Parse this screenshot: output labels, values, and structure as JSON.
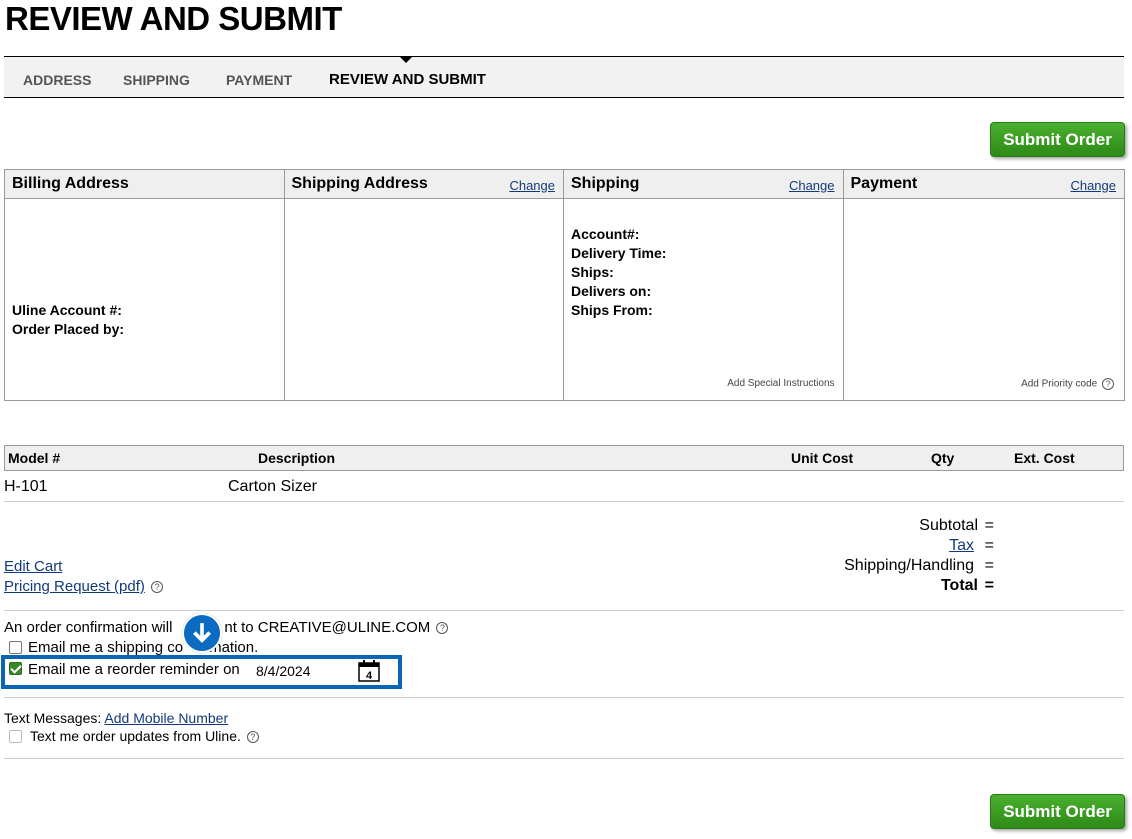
{
  "page": {
    "title": "REVIEW AND SUBMIT"
  },
  "steps": [
    {
      "label": "ADDRESS"
    },
    {
      "label": "SHIPPING"
    },
    {
      "label": "PAYMENT"
    },
    {
      "label": "REVIEW AND SUBMIT",
      "active": true
    }
  ],
  "submit_label": "Submit Order",
  "billing": {
    "heading": "Billing Address",
    "account_label": "Uline Account #:",
    "placed_by_label": "Order Placed by:"
  },
  "shipping_address": {
    "heading": "Shipping Address",
    "change": "Change"
  },
  "shipping": {
    "heading": "Shipping",
    "change": "Change",
    "fields": [
      "Account#:",
      "Delivery Time:",
      "Ships:",
      "Delivers on:",
      "Ships From:"
    ],
    "special_instructions": "Add Special Instructions"
  },
  "payment": {
    "heading": "Payment",
    "change": "Change",
    "priority_code": "Add Priority code"
  },
  "items": {
    "headers": {
      "model": "Model #",
      "description": "Description",
      "unit_cost": "Unit Cost",
      "qty": "Qty",
      "ext_cost": "Ext. Cost"
    },
    "rows": [
      {
        "model": "H-101",
        "description": "Carton Sizer"
      }
    ]
  },
  "links": {
    "edit_cart": "Edit Cart",
    "pricing_request": "Pricing Request (pdf)"
  },
  "totals": {
    "subtotal": "Subtotal",
    "tax": "Tax",
    "shipping": "Shipping/Handling",
    "total": "Total",
    "eq": "="
  },
  "email": {
    "confirmation_prefix": "An order confirmation will",
    "confirmation_suffix": "nt to CREATIVE@ULINE.COM",
    "shipping_confirmation": "Email me a shipping co",
    "shipping_confirmation_tail": "mation.",
    "reorder_label": "Email me a reorder reminder on",
    "reorder_date": "8/4/2024",
    "calendar_day": "4"
  },
  "text_messages": {
    "label": "Text Messages:",
    "add_mobile": "Add Mobile Number",
    "updates": "Text me order updates from Uline."
  },
  "colors": {
    "accent": "#0a66b5",
    "submit": "#3a9a22",
    "link": "#123a7a"
  },
  "icons": {
    "help": "question-circle-icon",
    "calendar": "calendar-icon",
    "arrow": "arrow-down-circle-icon",
    "step_caret": "caret-down-icon"
  }
}
